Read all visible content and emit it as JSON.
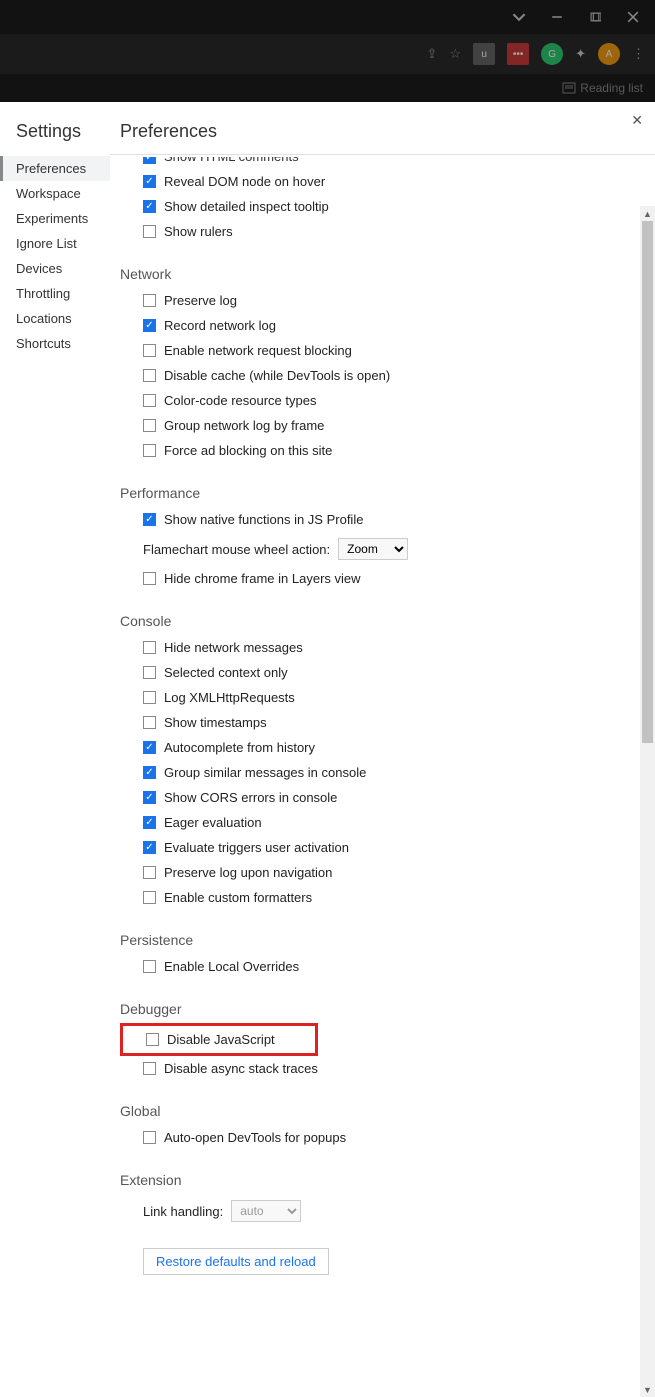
{
  "window": {
    "reading_list_label": "Reading list"
  },
  "extensions": {
    "avatar_letter": "A"
  },
  "sidebar": {
    "title": "Settings",
    "items": [
      "Preferences",
      "Workspace",
      "Experiments",
      "Ignore List",
      "Devices",
      "Throttling",
      "Locations",
      "Shortcuts"
    ],
    "selected_index": 0
  },
  "page": {
    "title": "Preferences",
    "restore_label": "Restore defaults and reload"
  },
  "sections": {
    "elements_cut": {
      "item0": "Show HTML comments"
    },
    "elements": {
      "reveal": "Reveal DOM node on hover",
      "tooltip": "Show detailed inspect tooltip",
      "rulers": "Show rulers"
    },
    "network": {
      "title": "Network",
      "preserve": "Preserve log",
      "record": "Record network log",
      "blocking": "Enable network request blocking",
      "cache": "Disable cache (while DevTools is open)",
      "color": "Color-code resource types",
      "group": "Group network log by frame",
      "adblock": "Force ad blocking on this site"
    },
    "performance": {
      "title": "Performance",
      "native": "Show native functions in JS Profile",
      "wheel_label": "Flamechart mouse wheel action:",
      "wheel_value": "Zoom",
      "hide_chrome": "Hide chrome frame in Layers view"
    },
    "console": {
      "title": "Console",
      "hide_net": "Hide network messages",
      "context": "Selected context only",
      "xhr": "Log XMLHttpRequests",
      "ts": "Show timestamps",
      "auto": "Autocomplete from history",
      "group": "Group similar messages in console",
      "cors": "Show CORS errors in console",
      "eager": "Eager evaluation",
      "eval": "Evaluate triggers user activation",
      "preserve": "Preserve log upon navigation",
      "formatters": "Enable custom formatters"
    },
    "persistence": {
      "title": "Persistence",
      "overrides": "Enable Local Overrides"
    },
    "debugger": {
      "title": "Debugger",
      "disable_js": "Disable JavaScript",
      "async": "Disable async stack traces"
    },
    "global": {
      "title": "Global",
      "auto_open": "Auto-open DevTools for popups"
    },
    "extension": {
      "title": "Extension",
      "link_label": "Link handling:",
      "link_value": "auto"
    }
  }
}
